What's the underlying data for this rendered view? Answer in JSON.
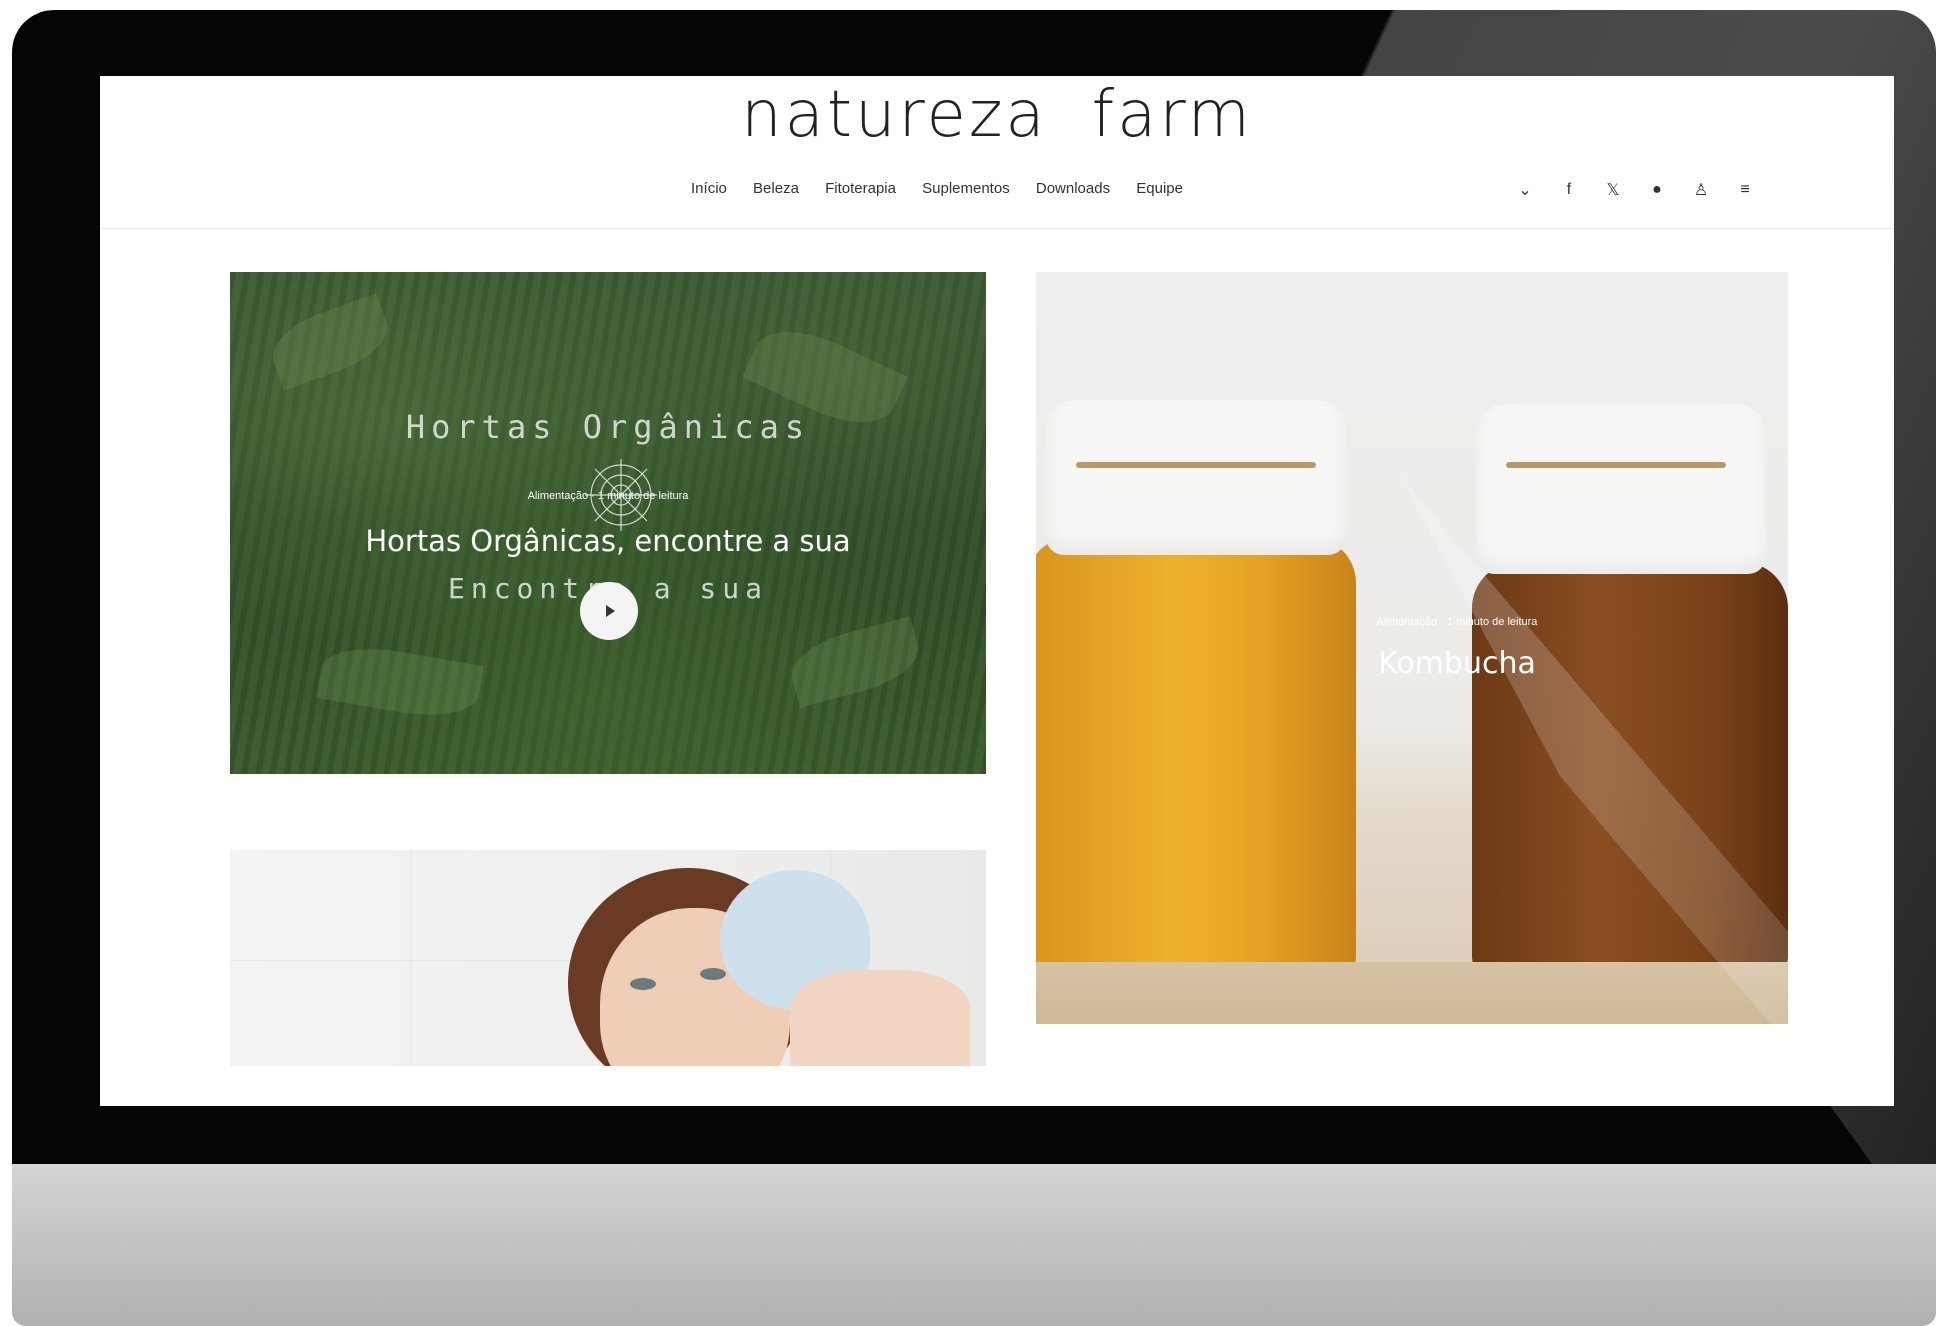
{
  "site": {
    "brand_left": "natureza",
    "brand_right": "farm"
  },
  "nav": {
    "items": [
      "Início",
      "Beleza",
      "Fitoterapia",
      "Suplementos",
      "Downloads",
      "Equipe"
    ],
    "icons": [
      "chevron-down-icon",
      "facebook-icon",
      "twitter-icon",
      "youtube-icon",
      "user-icon",
      "menu-icon"
    ],
    "icon_glyphs": [
      "⌄",
      "f",
      "𝕏",
      "●",
      "♙",
      "≡"
    ]
  },
  "cards": {
    "hortas": {
      "overlay_title": "Hortas Orgânicas",
      "overlay_subtitle": "Encontre a sua",
      "meta": "Alimentação · 1 minuto de leitura",
      "title": "Hortas Orgânicas, encontre a sua"
    },
    "kombucha": {
      "meta": "Alimentação · 1 minuto de leitura",
      "title": "Kombucha"
    }
  },
  "colors": {
    "accent_text": "#222222",
    "card_overlay_text": "#ffffff"
  }
}
